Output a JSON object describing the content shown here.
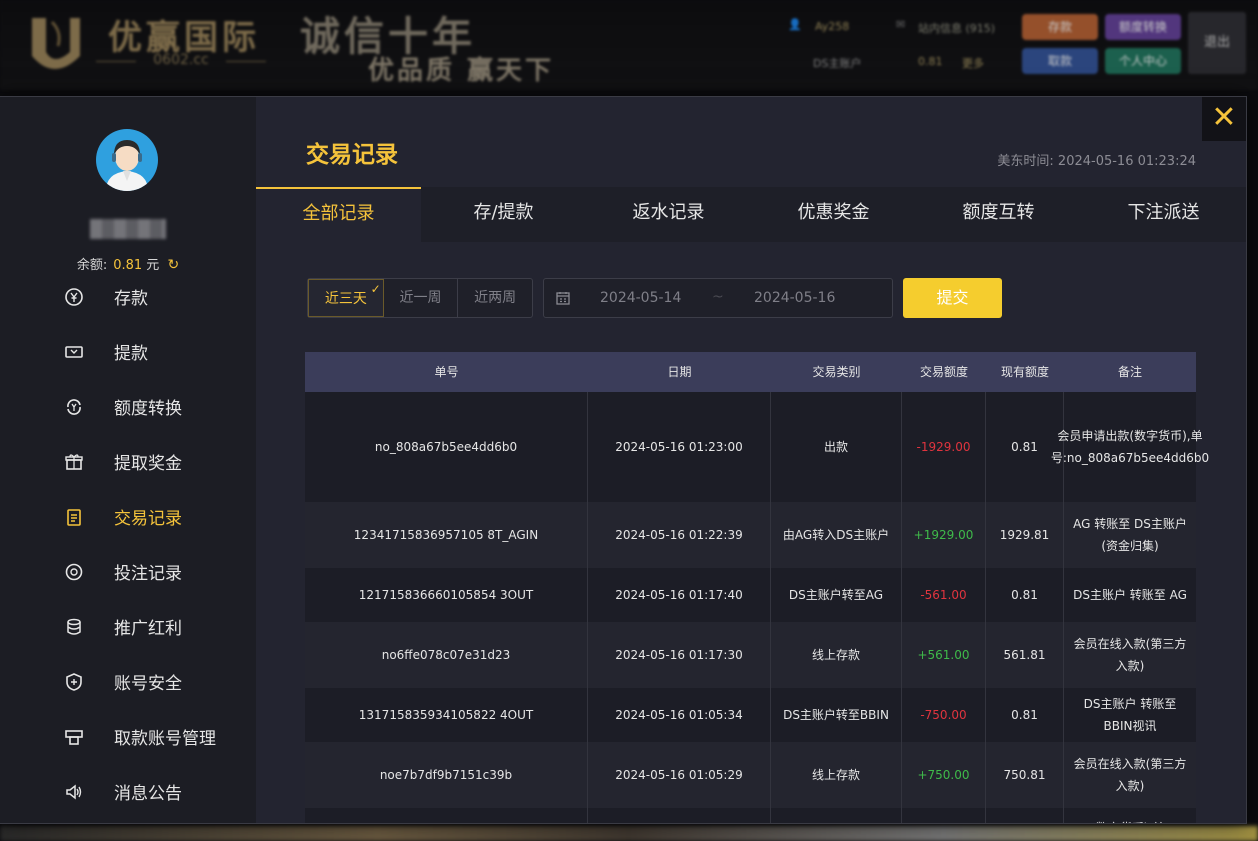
{
  "header": {
    "logo_text": "优赢国际",
    "logo_sub": "0602.cc",
    "slogan_main": "诚信十年",
    "slogan_sub": "优品质 赢天下",
    "user": "Ay258",
    "mail": "站内信息 (915)",
    "account": "DS主账户",
    "account_balance": "0.81",
    "account_action": "更多",
    "btn_deposit": "存款",
    "btn_transfer": "额度转换",
    "btn_withdraw": "取款",
    "btn_center": "个人中心",
    "btn_logout": "退出"
  },
  "sidebar": {
    "balance_label": "余额:",
    "balance_value": "0.81",
    "balance_unit": "元",
    "items": [
      {
        "label": "存款"
      },
      {
        "label": "提款"
      },
      {
        "label": "额度转换"
      },
      {
        "label": "提取奖金"
      },
      {
        "label": "交易记录"
      },
      {
        "label": "投注记录"
      },
      {
        "label": "推广红利"
      },
      {
        "label": "账号安全"
      },
      {
        "label": "取款账号管理"
      },
      {
        "label": "消息公告"
      }
    ]
  },
  "content": {
    "title": "交易记录",
    "time_label": "美东时间:",
    "time_value": "2024-05-16 01:23:24",
    "tabs": [
      "全部记录",
      "存/提款",
      "返水记录",
      "优惠奖金",
      "额度互转",
      "下注派送"
    ],
    "ranges": [
      "近三天",
      "近一周",
      "近两周"
    ],
    "date_from": "2024-05-14",
    "date_sep": "~",
    "date_to": "2024-05-16",
    "submit": "提交"
  },
  "table": {
    "headers": [
      "单号",
      "日期",
      "交易类别",
      "交易额度",
      "现有额度",
      "备注"
    ],
    "rows": [
      {
        "id": "no_808a67b5ee4dd6b0",
        "date": "2024-05-16 01:23:00",
        "type": "出款",
        "amount": "-1929.00",
        "balance": "0.81",
        "note": "会员申请出款(数字货币),单号:no_808a67b5ee4dd6b0"
      },
      {
        "id": "12341715836957105 8T_AGIN",
        "date": "2024-05-16 01:22:39",
        "type": "由AG转入DS主账户",
        "amount": "+1929.00",
        "balance": "1929.81",
        "note": "AG 转账至 DS主账户(资金归集)"
      },
      {
        "id": "121715836660105854 3OUT",
        "date": "2024-05-16 01:17:40",
        "type": "DS主账户转至AG",
        "amount": "-561.00",
        "balance": "0.81",
        "note": "DS主账户 转账至 AG"
      },
      {
        "id": "no6ffe078c07e31d23",
        "date": "2024-05-16 01:17:30",
        "type": "线上存款",
        "amount": "+561.00",
        "balance": "561.81",
        "note": "会员在线入款(第三方入款)"
      },
      {
        "id": "131715835934105822 4OUT",
        "date": "2024-05-16 01:05:34",
        "type": "DS主账户转至BBIN",
        "amount": "-750.00",
        "balance": "0.81",
        "note": "DS主账户 转账至 BBIN视讯"
      },
      {
        "id": "noe7b7df9b7151c39b",
        "date": "2024-05-16 01:05:29",
        "type": "线上存款",
        "amount": "+750.00",
        "balance": "750.81",
        "note": "会员在线入款(第三方入款)"
      },
      {
        "id": "",
        "date": "",
        "type": "",
        "amount": "",
        "balance": "",
        "note": "数字货币),单"
      }
    ]
  }
}
